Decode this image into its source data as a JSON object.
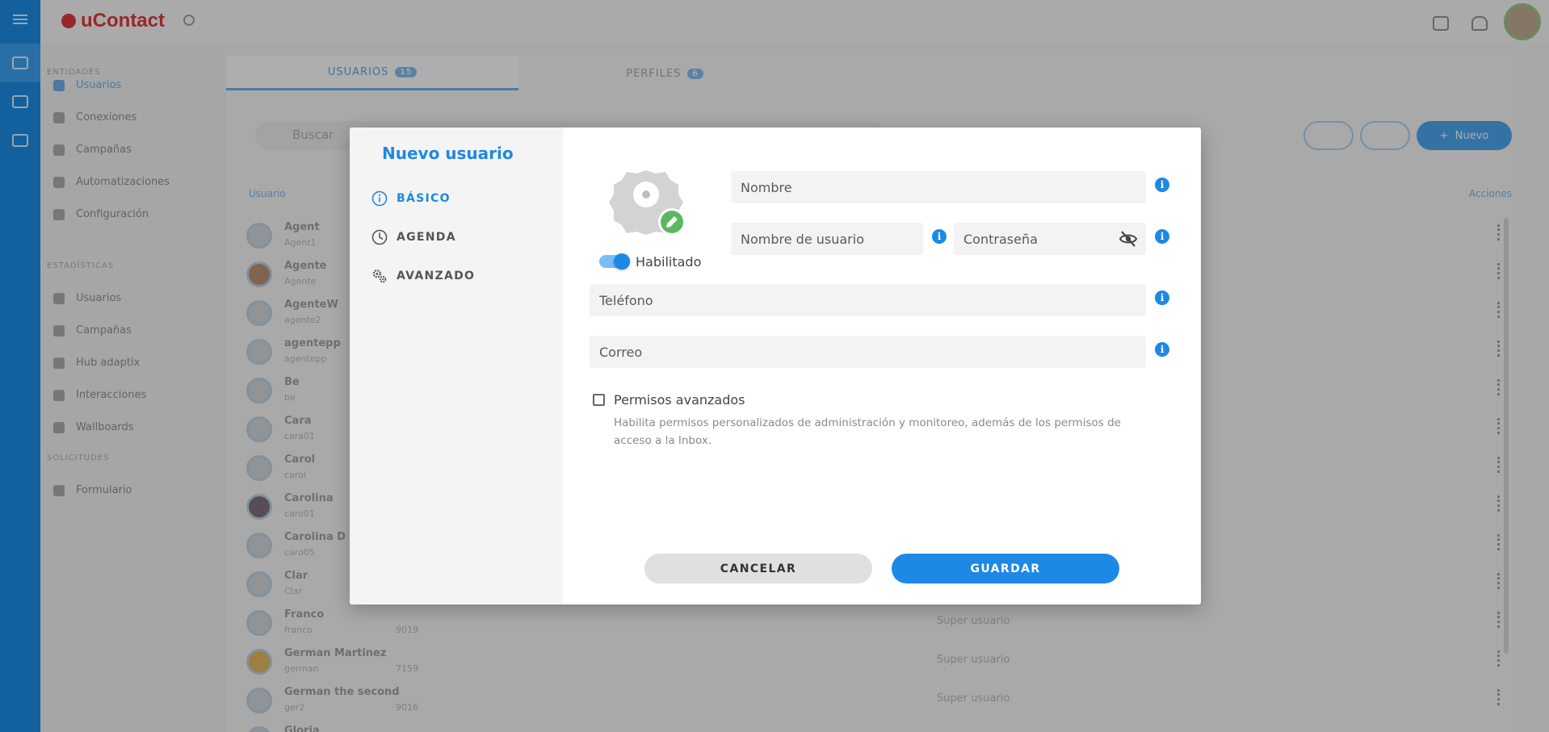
{
  "background": {
    "logo": "uContact",
    "tabs": [
      {
        "label": "USUARIOS",
        "badge": "15"
      },
      {
        "label": "PERFILES",
        "badge": "6"
      }
    ],
    "search_placeholder": "Buscar",
    "new_button": "Nuevo",
    "col_user": "Usuario",
    "col_actions": "Acciones",
    "sidebar": {
      "sections": [
        {
          "header": "ENTIDADES",
          "items": [
            "Usuarios",
            "Conexiones",
            "Campañas",
            "Automatizaciones",
            "Configuración"
          ]
        },
        {
          "header": "ESTADÍSTICAS",
          "items": [
            "Usuarios",
            "Campañas",
            "Hub adaptix",
            "Interacciones",
            "Wallboards"
          ]
        },
        {
          "header": "SOLICITUDES",
          "items": [
            "Formulario"
          ]
        }
      ]
    },
    "rows": [
      {
        "name": "Agent",
        "sub": "Agent1",
        "ext": "",
        "role": ""
      },
      {
        "name": "Agente",
        "sub": "Agente",
        "ext": "",
        "role": ""
      },
      {
        "name": "AgenteW",
        "sub": "agente2",
        "ext": "",
        "role": ""
      },
      {
        "name": "agentepp",
        "sub": "agentepp",
        "ext": "",
        "role": ""
      },
      {
        "name": "Be",
        "sub": "be",
        "ext": "",
        "role": ""
      },
      {
        "name": "Cara",
        "sub": "cara01",
        "ext": "",
        "role": ""
      },
      {
        "name": "Carol",
        "sub": "carol",
        "ext": "",
        "role": ""
      },
      {
        "name": "Carolina",
        "sub": "caro01",
        "ext": "",
        "role": ""
      },
      {
        "name": "Carolina D",
        "sub": "caro05",
        "ext": "",
        "role": ""
      },
      {
        "name": "Clar",
        "sub": "Clar",
        "ext": "",
        "role": ""
      },
      {
        "name": "Franco",
        "sub": "franco",
        "ext": "9019",
        "role": "Super usuario"
      },
      {
        "name": "German Martinez",
        "sub": "german",
        "ext": "7159",
        "role": "Super usuario"
      },
      {
        "name": "German the second",
        "sub": "ger2",
        "ext": "9016",
        "role": "Super usuario"
      },
      {
        "name": "Gloria",
        "sub": "",
        "ext": "",
        "role": ""
      }
    ]
  },
  "modal": {
    "title": "Nuevo usuario",
    "nav": [
      {
        "label": "BÁSICO",
        "icon": "info-circle-icon",
        "active": true
      },
      {
        "label": "AGENDA",
        "icon": "clock-icon",
        "active": false
      },
      {
        "label": "AVANZADO",
        "icon": "gears-icon",
        "active": false
      }
    ],
    "enabled_label": "Habilitado",
    "enabled": true,
    "fields": {
      "name_placeholder": "Nombre",
      "username_placeholder": "Nombre de usuario",
      "password_placeholder": "Contraseña",
      "phone_placeholder": "Teléfono",
      "email_placeholder": "Correo"
    },
    "advanced_permissions_label": "Permisos avanzados",
    "advanced_permissions_help": "Habilita permisos personalizados de administración y monitoreo, además de los permisos de acceso a la Inbox.",
    "advanced_permissions_checked": false,
    "cancel_label": "CANCELAR",
    "save_label": "GUARDAR",
    "accent_color": "#1e88e5"
  }
}
